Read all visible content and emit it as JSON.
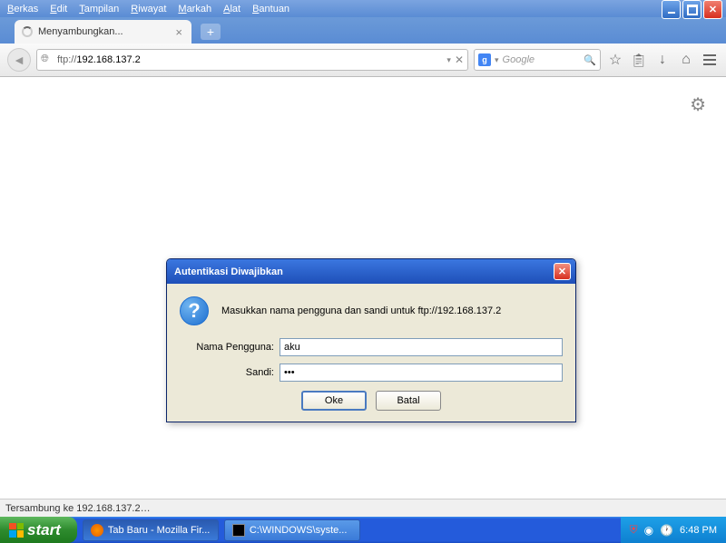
{
  "menu": {
    "items": [
      "Berkas",
      "Edit",
      "Tampilan",
      "Riwayat",
      "Markah",
      "Alat",
      "Bantuan"
    ]
  },
  "tab": {
    "title": "Menyambungkan..."
  },
  "url": {
    "prefix": "ftp://",
    "host": "192.168.137.2"
  },
  "search": {
    "placeholder": "Google"
  },
  "dialog": {
    "title": "Autentikasi Diwajibkan",
    "message": "Masukkan nama pengguna dan sandi untuk ftp://192.168.137.2",
    "username_label": "Nama Pengguna:",
    "username_value": "aku",
    "password_label": "Sandi:",
    "password_value": "•••",
    "ok": "Oke",
    "cancel": "Batal"
  },
  "status": "Tersambung ke 192.168.137.2…",
  "taskbar": {
    "start": "start",
    "firefox": "Tab Baru - Mozilla Fir...",
    "cmd": "C:\\WINDOWS\\syste...",
    "time": "6:48 PM"
  }
}
